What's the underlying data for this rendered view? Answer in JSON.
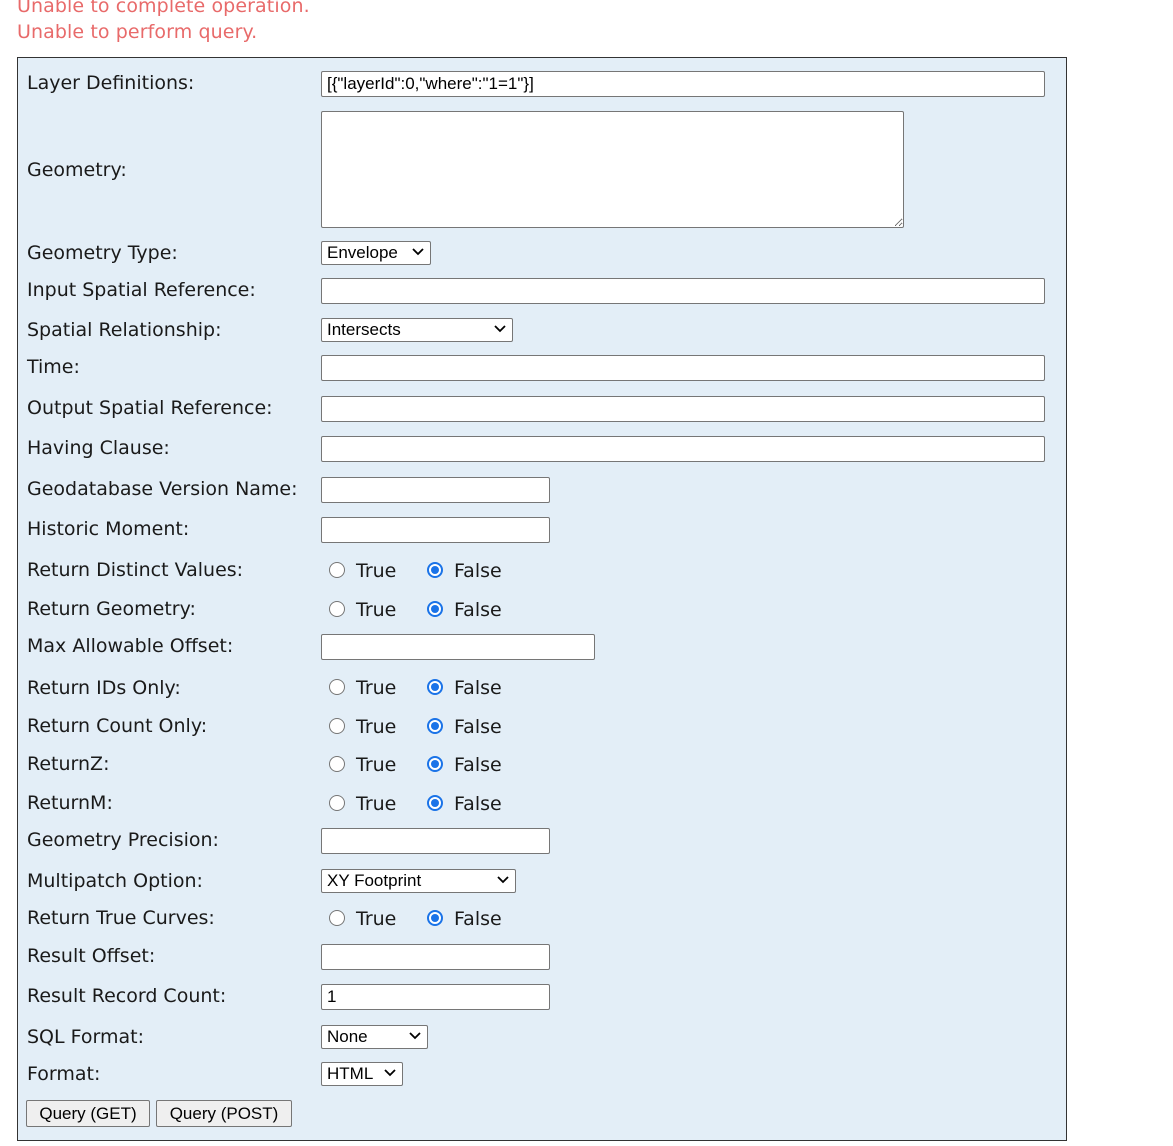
{
  "errors": [
    "Unable to complete operation.",
    "Unable to perform query."
  ],
  "form": {
    "layer_definitions": {
      "label": "Layer Definitions:",
      "value": "[{\"layerId\":0,\"where\":\"1=1\"}]"
    },
    "geometry": {
      "label": "Geometry:",
      "value": ""
    },
    "geometry_type": {
      "label": "Geometry Type:",
      "selected": "Envelope"
    },
    "input_spatial_reference": {
      "label": "Input Spatial Reference:",
      "value": ""
    },
    "spatial_relationship": {
      "label": "Spatial Relationship:",
      "selected": "Intersects"
    },
    "time": {
      "label": "Time:",
      "value": ""
    },
    "output_spatial_reference": {
      "label": "Output Spatial Reference:",
      "value": ""
    },
    "having_clause": {
      "label": "Having Clause:",
      "value": ""
    },
    "gdb_version": {
      "label": "Geodatabase Version Name:",
      "value": ""
    },
    "historic_moment": {
      "label": "Historic Moment:",
      "value": ""
    },
    "return_distinct_values": {
      "label": "Return Distinct Values:",
      "value": "False"
    },
    "return_geometry": {
      "label": "Return Geometry:",
      "value": "False"
    },
    "max_allowable_offset": {
      "label": "Max Allowable Offset:",
      "value": ""
    },
    "return_ids_only": {
      "label": "Return IDs Only:",
      "value": "False"
    },
    "return_count_only": {
      "label": "Return Count Only:",
      "value": "False"
    },
    "return_z": {
      "label": "ReturnZ:",
      "value": "False"
    },
    "return_m": {
      "label": "ReturnM:",
      "value": "False"
    },
    "geometry_precision": {
      "label": "Geometry Precision:",
      "value": ""
    },
    "multipatch_option": {
      "label": "Multipatch Option:",
      "selected": "XY Footprint"
    },
    "return_true_curves": {
      "label": "Return True Curves:",
      "value": "False"
    },
    "result_offset": {
      "label": "Result Offset:",
      "value": ""
    },
    "result_record_count": {
      "label": "Result Record Count:",
      "value": "1"
    },
    "sql_format": {
      "label": "SQL Format:",
      "selected": "None"
    },
    "format": {
      "label": "Format:",
      "selected": "HTML"
    }
  },
  "radio_options": {
    "true_label": "True",
    "false_label": "False"
  },
  "buttons": {
    "query_get": "Query (GET)",
    "query_post": "Query (POST)"
  },
  "colors": {
    "error": "#e86a6a",
    "panel_bg": "#e3eef7",
    "radio_accent": "#1a73e8"
  }
}
